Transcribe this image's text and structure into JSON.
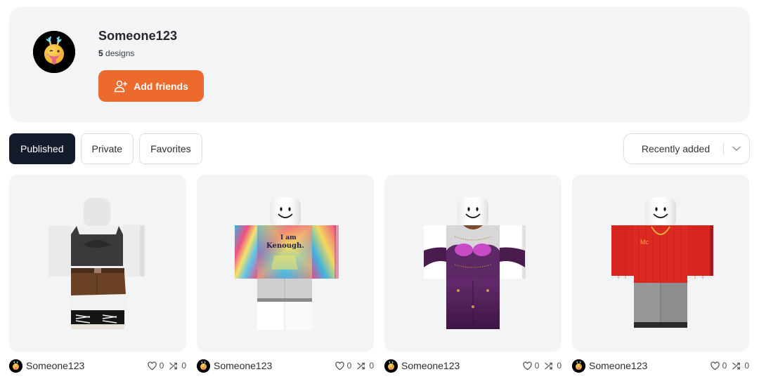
{
  "profile": {
    "username": "Someone123",
    "designs_count": "5",
    "designs_label": "designs",
    "avatar_icon": "emoji-face-tongue-icon",
    "add_friends_label": "Add friends",
    "add_friends_icon": "user-plus-icon"
  },
  "tabs": [
    {
      "label": "Published",
      "active": true
    },
    {
      "label": "Private",
      "active": false
    },
    {
      "label": "Favorites",
      "active": false
    }
  ],
  "sort": {
    "selected": "Recently added",
    "icon": "chevron-down-icon"
  },
  "colors": {
    "accent": "#ec6a2c",
    "active_tab": "#141b2b",
    "card_bg": "#f3f4f6"
  },
  "designs": [
    {
      "author": "Someone123",
      "likes": "0",
      "remixes": "0",
      "outfit": "black crop top, brown belted skirt, black-white sneakers"
    },
    {
      "author": "Someone123",
      "likes": "0",
      "remixes": "0",
      "outfit": "tie-dye hoodie 'I am Kenough.', grey shorts"
    },
    {
      "author": "Someone123",
      "likes": "0",
      "remixes": "0",
      "outfit": "purple gown with gold chains"
    },
    {
      "author": "Someone123",
      "likes": "0",
      "remixes": "0",
      "outfit": "red sweater 'Mc' with gold chain, grey jeans"
    }
  ],
  "shirt_texts": {
    "kenough_line1": "I am",
    "kenough_line2": "Kenough.",
    "mc": "Mc"
  }
}
